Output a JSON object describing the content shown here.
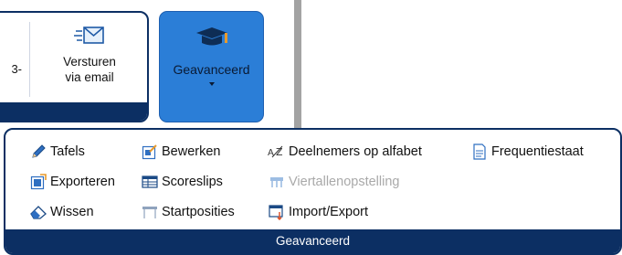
{
  "ribbon": {
    "truncated_label": "3-",
    "send_button": {
      "line1": "Versturen",
      "line2": "via email",
      "icon": "envelope-icon"
    },
    "advanced_button": {
      "label": "Geavanceerd",
      "icon": "graduation-cap-icon"
    }
  },
  "panel": {
    "title": "Geavanceerd",
    "items": [
      {
        "label": "Tafels",
        "icon": "pencil-icon",
        "enabled": true
      },
      {
        "label": "Exporteren",
        "icon": "export-icon",
        "enabled": true
      },
      {
        "label": "Wissen",
        "icon": "eraser-icon",
        "enabled": true
      },
      {
        "label": "Bewerken",
        "icon": "edit-icon",
        "enabled": true
      },
      {
        "label": "Scoreslips",
        "icon": "table-icon",
        "enabled": true
      },
      {
        "label": "Startposities",
        "icon": "table-header-icon",
        "enabled": true
      },
      {
        "label": "Deelnemers op alfabet",
        "icon": "sort-az-icon",
        "enabled": true
      },
      {
        "label": "Viertallenopstelling",
        "icon": "foursome-icon",
        "enabled": false
      },
      {
        "label": "Import/Export",
        "icon": "import-export-icon",
        "enabled": true
      },
      {
        "label": "Frequentiestaat",
        "icon": "document-chart-icon",
        "enabled": true
      }
    ]
  },
  "colors": {
    "navy": "#0c2f63",
    "accent_blue": "#2b7ed7",
    "disabled_text": "#a9a9a9"
  }
}
